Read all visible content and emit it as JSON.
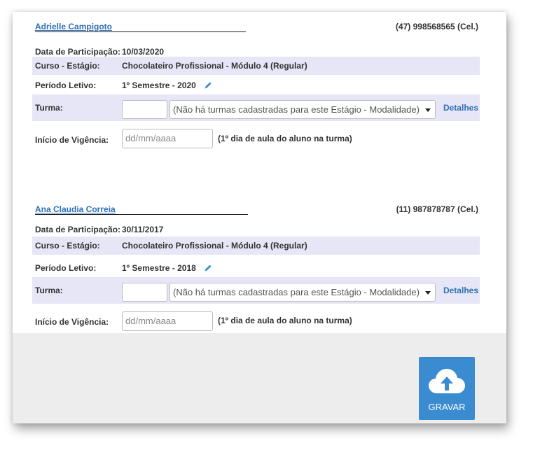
{
  "students": [
    {
      "name": "Adrielle Campigoto",
      "phone": "(47) 998568565 (Cel.)",
      "participation_label": "Data de Participação:",
      "participation_date": "10/03/2020",
      "course_label": "Curso - Estágio:",
      "course_value": "Chocolateiro Profissional - Módulo 4 (Regular)",
      "period_label": "Período Letivo:",
      "period_value": "1º Semestre - 2020",
      "class_label": "Turma:",
      "class_code": "",
      "class_select_value": "(Não há turmas cadastradas para este Estágio - Modalidade)",
      "details_link": "Detalhes",
      "start_label": "Início de Vigência:",
      "start_placeholder": "dd/mm/aaaa",
      "start_hint": "(1º dia de aula do aluno na turma)"
    },
    {
      "name": "Ana Claudia Correia",
      "phone": "(11) 987878787 (Cel.)",
      "participation_label": "Data de Participação:",
      "participation_date": "30/11/2017",
      "course_label": "Curso - Estágio:",
      "course_value": "Chocolateiro Profissional - Módulo 4 (Regular)",
      "period_label": "Período Letivo:",
      "period_value": "1º Semestre - 2018",
      "class_label": "Turma:",
      "class_code": "",
      "class_select_value": "(Não há turmas cadastradas para este Estágio - Modalidade)",
      "details_link": "Detalhes",
      "start_label": "Início de Vigência:",
      "start_placeholder": "dd/mm/aaaa",
      "start_hint": "(1º dia de aula do aluno na turma)"
    }
  ],
  "actions": {
    "save_label": "GRAVAR",
    "save_icon": "cloud-upload-icon"
  },
  "colors": {
    "accent": "#3a8bd0",
    "link": "#2f6fb5",
    "row_shade": "#e6e6f7"
  }
}
